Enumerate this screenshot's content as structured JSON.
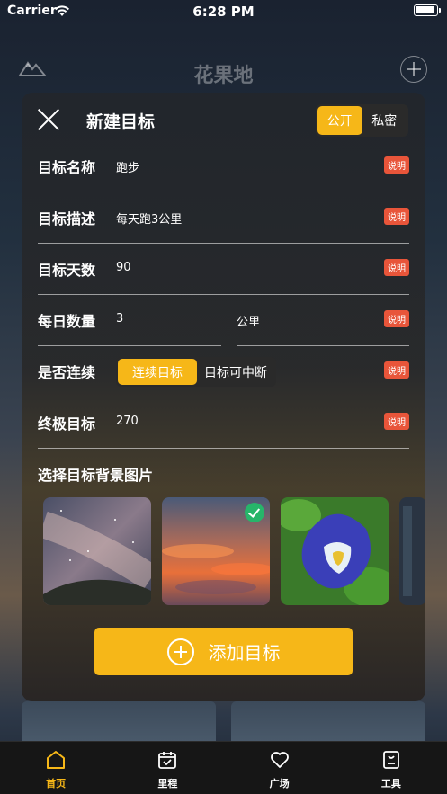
{
  "status_bar": {
    "carrier": "Carrier",
    "time": "6:28 PM"
  },
  "app": {
    "title": "花果地"
  },
  "modal": {
    "title": "新建目标",
    "visibility": {
      "options": [
        "公开",
        "私密"
      ],
      "selected": "公开"
    },
    "help_label": "说明",
    "fields": {
      "name": {
        "label": "目标名称",
        "value": "跑步"
      },
      "description": {
        "label": "目标描述",
        "value": "每天跑3公里"
      },
      "days": {
        "label": "目标天数",
        "value": "90"
      },
      "daily": {
        "label": "每日数量",
        "value": "3",
        "unit": "公里"
      },
      "continuous": {
        "label": "是否连续",
        "options": [
          "连续目标",
          "目标可中断"
        ],
        "selected": "连续目标"
      },
      "ultimate": {
        "label": "终极目标",
        "value": "270"
      }
    },
    "background_picker": {
      "title": "选择目标背景图片",
      "images": [
        {
          "name": "milky-way-hill",
          "selected": false
        },
        {
          "name": "sunset-clouds",
          "selected": true
        },
        {
          "name": "blue-flower",
          "selected": false
        },
        {
          "name": "dark-partial",
          "selected": false
        }
      ]
    },
    "add_button": "添加目标"
  },
  "tabbar": {
    "items": [
      {
        "label": "首页",
        "icon": "home-icon",
        "active": true
      },
      {
        "label": "里程",
        "icon": "calendar-icon",
        "active": false
      },
      {
        "label": "广场",
        "icon": "heart-icon",
        "active": false
      },
      {
        "label": "工具",
        "icon": "toolbox-icon",
        "active": false
      }
    ]
  },
  "colors": {
    "accent": "#f6b718",
    "help_badge": "#e8553a",
    "check": "#27b56a"
  }
}
